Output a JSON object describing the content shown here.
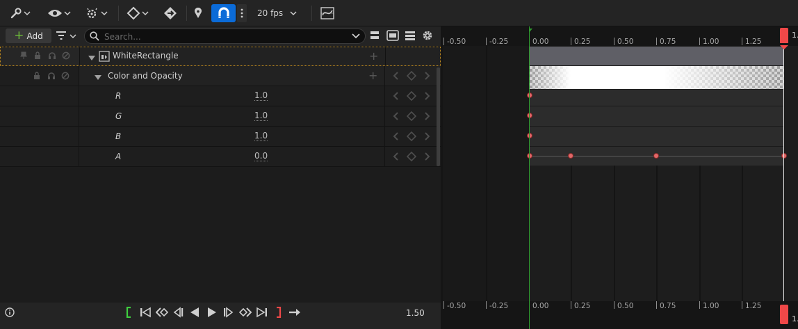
{
  "toolbar": {
    "fps": "20 fps"
  },
  "outliner": {
    "add_label": "Add",
    "search_placeholder": "Search...",
    "rows": [
      {
        "label": "WhiteRectangle"
      },
      {
        "label": "Color and Opacity"
      },
      {
        "label": "R",
        "value": "1.0"
      },
      {
        "label": "G",
        "value": "1.0"
      },
      {
        "label": "B",
        "value": "1.0"
      },
      {
        "label": "A",
        "value": "0.0"
      }
    ]
  },
  "timeline": {
    "ruler_labels": [
      "-0.50",
      "-0.25",
      "0.00",
      "0.25",
      "0.50",
      "0.75",
      "1.00",
      "1.25"
    ],
    "end_marker_label": "1.",
    "start_marker_color": "#2f9a2f",
    "end_marker_color": "#f04848"
  },
  "playback": {
    "current_time": "1.50"
  },
  "colors": {
    "accent": "#0b6bd8",
    "key": "#e06868",
    "selection_border": "#c08a1e"
  }
}
